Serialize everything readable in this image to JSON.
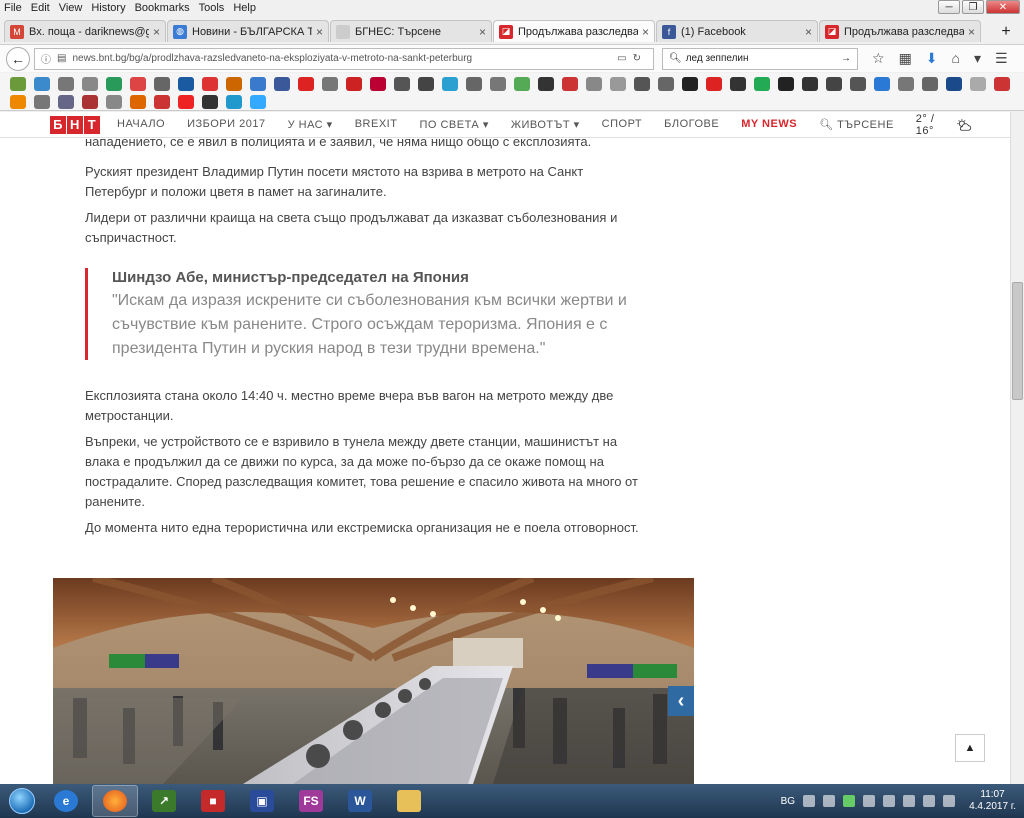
{
  "menubar": {
    "items": [
      "File",
      "Edit",
      "View",
      "History",
      "Bookmarks",
      "Tools",
      "Help"
    ]
  },
  "tabs": [
    {
      "title": "Вх. поща - dariknews@g...",
      "icon": "gmail-icon",
      "color": "#d44638",
      "glyph": "M"
    },
    {
      "title": "Новини - БЪЛГАРСКА Т...",
      "icon": "globe-icon",
      "color": "#3a7bd5",
      "glyph": "◍"
    },
    {
      "title": "БГНЕС: Търсене",
      "icon": "blank-page-icon",
      "color": "#ccc",
      "glyph": ""
    },
    {
      "title": "Продължава разследван...",
      "icon": "bnt-icon",
      "color": "#d7262c",
      "glyph": "◪"
    },
    {
      "title": "(1) Facebook",
      "icon": "facebook-icon",
      "color": "#3b5998",
      "glyph": "f"
    },
    {
      "title": "Продължава разследван...",
      "icon": "bnt-icon",
      "color": "#d7262c",
      "glyph": "◪"
    }
  ],
  "navbar": {
    "url": "news.bnt.bg/bg/a/prodlzhava-razsledvaneto-na-eksploziyata-v-metroto-na-sankt-peterburg",
    "search": "лед зеппелин"
  },
  "site": {
    "logo": [
      "Б",
      "Н",
      "Т"
    ],
    "nav": [
      {
        "label": "НАЧАЛО",
        "red": false
      },
      {
        "label": "ИЗБОРИ 2017",
        "red": false
      },
      {
        "label": "У НАС ▾",
        "red": false
      },
      {
        "label": "BREXIT",
        "red": false
      },
      {
        "label": "ПО СВЕТА ▾",
        "red": false
      },
      {
        "label": "ЖИВОТЪТ ▾",
        "red": false
      },
      {
        "label": "СПОРТ",
        "red": false
      },
      {
        "label": "БЛОГОВЕ",
        "red": false
      },
      {
        "label": "MY NEWS",
        "red": true
      },
      {
        "label": "ТЪРСЕНЕ",
        "red": false
      }
    ],
    "weather": "2° / 16°"
  },
  "article": {
    "p0": "нападението, се е явил в полицията и е заявил, че няма нищо общо с експлозията.",
    "p1": "Руският президент Владимир Путин посети мястото на взрива в метрото на Санкт Петербург и положи цветя в памет на загиналите.",
    "p2": "Лидери от различни краища на света също продължават да изказват съболезнования и съпричастност.",
    "quote_author": "Шиндзо Абе, министър-председател на Япония",
    "quote_text": "\"Искам да изразя искрените си съболезнования към всички жертви и съчувствие към ранените. Строго осъждам тероризма. Япония е с президента Путин и руския народ в тези трудни времена.\"",
    "p3": "Експлозията стана около 14:40 ч. местно време вчера във вагон на метрото между две метростанции.",
    "p4": "Въпреки, че устройството се е взривило в тунела между двете станции, машинистът на влака е продължил да се движи по курса, за да може по-бързо да се окаже помощ на пострадалите. Според разследващия комитет, това решение е спасило живота на много от ранените.",
    "p5": "До момента нито една терористична или екстремиска организация не е поела отговорност."
  },
  "taskbar": {
    "lang": "BG",
    "time": "11:07",
    "date": "4.4.2017 г."
  }
}
